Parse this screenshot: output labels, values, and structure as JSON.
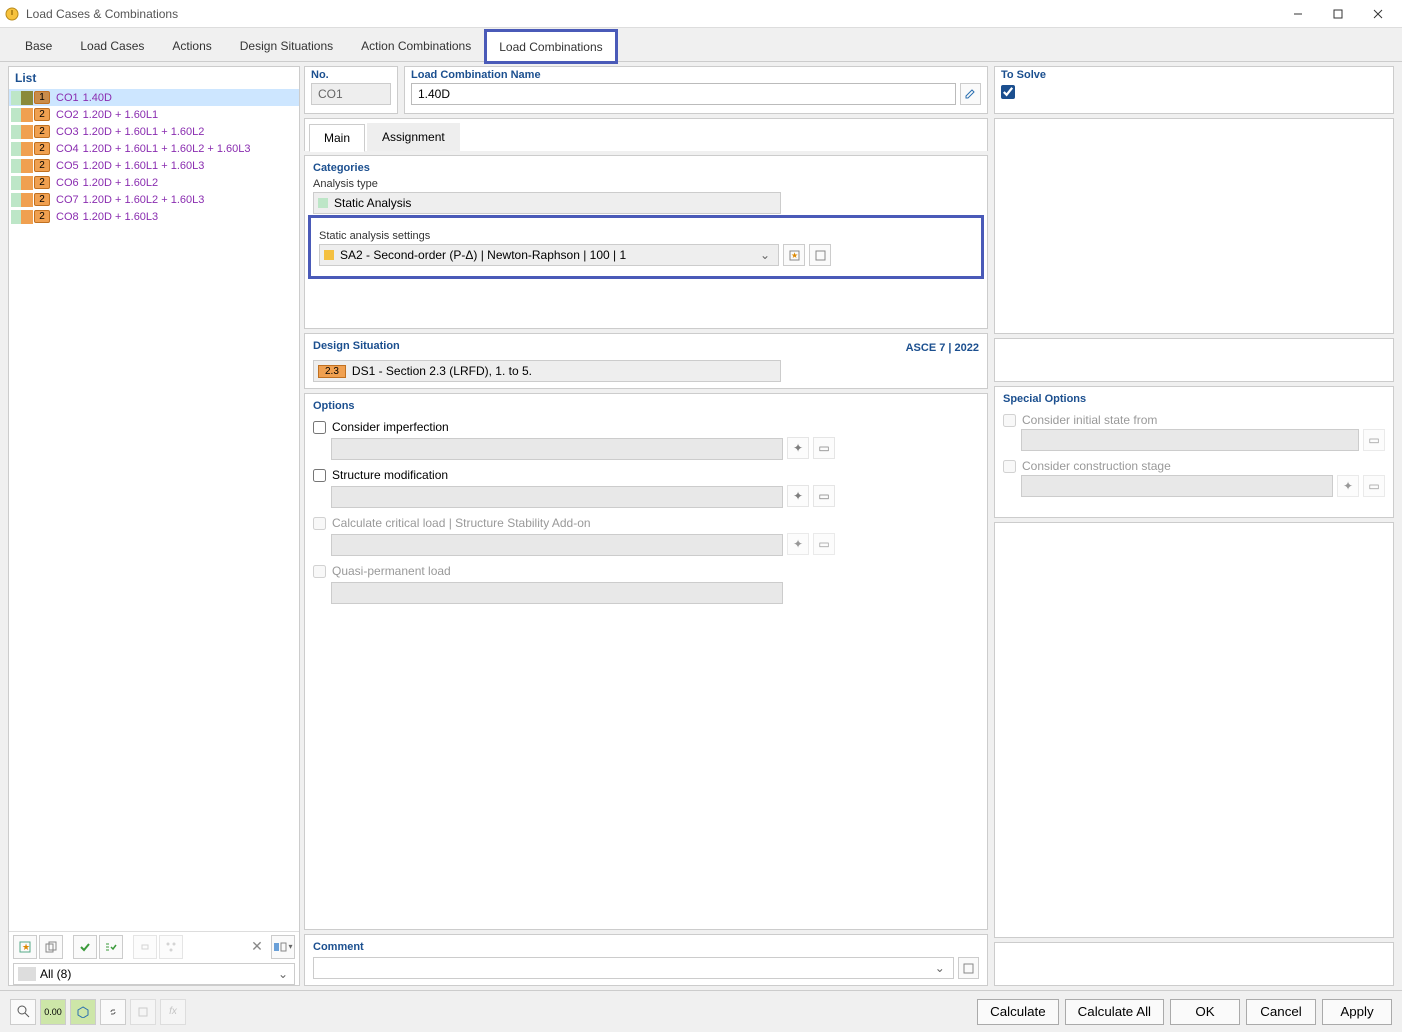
{
  "window": {
    "title": "Load Cases & Combinations"
  },
  "tabs": {
    "items": [
      "Base",
      "Load Cases",
      "Actions",
      "Design Situations",
      "Action Combinations",
      "Load Combinations"
    ],
    "active": 5
  },
  "list": {
    "header": "List",
    "rows": [
      {
        "idx": "1",
        "co": "CO1",
        "name": "1.40D",
        "sw1": "#bde6c7",
        "sw2": "#8a8a3a",
        "sel": true
      },
      {
        "idx": "2",
        "co": "CO2",
        "name": "1.20D + 1.60L1",
        "sw1": "#bde6c7",
        "sw2": "#f0a050",
        "sel": false
      },
      {
        "idx": "2",
        "co": "CO3",
        "name": "1.20D + 1.60L1 + 1.60L2",
        "sw1": "#bde6c7",
        "sw2": "#f0a050",
        "sel": false
      },
      {
        "idx": "2",
        "co": "CO4",
        "name": "1.20D + 1.60L1 + 1.60L2 + 1.60L3",
        "sw1": "#bde6c7",
        "sw2": "#f0a050",
        "sel": false
      },
      {
        "idx": "2",
        "co": "CO5",
        "name": "1.20D + 1.60L1 + 1.60L3",
        "sw1": "#bde6c7",
        "sw2": "#f0a050",
        "sel": false
      },
      {
        "idx": "2",
        "co": "CO6",
        "name": "1.20D + 1.60L2",
        "sw1": "#bde6c7",
        "sw2": "#f0a050",
        "sel": false
      },
      {
        "idx": "2",
        "co": "CO7",
        "name": "1.20D + 1.60L2 + 1.60L3",
        "sw1": "#bde6c7",
        "sw2": "#f0a050",
        "sel": false
      },
      {
        "idx": "2",
        "co": "CO8",
        "name": "1.20D + 1.60L3",
        "sw1": "#bde6c7",
        "sw2": "#f0a050",
        "sel": false
      }
    ],
    "filter": "All (8)"
  },
  "detail": {
    "no_label": "No.",
    "no_value": "CO1",
    "name_label": "Load Combination Name",
    "name_value": "1.40D",
    "solve_label": "To Solve",
    "subtabs": [
      "Main",
      "Assignment"
    ],
    "categories": {
      "title": "Categories",
      "analysis_type_label": "Analysis type",
      "analysis_type_value": "Static Analysis",
      "sas_label": "Static analysis settings",
      "sas_value": "SA2 - Second-order (P-Δ) | Newton-Raphson | 100 | 1"
    },
    "design_situation": {
      "title": "Design Situation",
      "right": "ASCE 7 | 2022",
      "badge": "2.3",
      "value": "DS1 - Section 2.3 (LRFD), 1. to 5."
    },
    "options": {
      "title": "Options",
      "imperf": "Consider imperfection",
      "struct_mod": "Structure modification",
      "crit_load": "Calculate critical load | Structure Stability Add-on",
      "quasi": "Quasi-permanent load"
    },
    "special": {
      "title": "Special Options",
      "init_state": "Consider initial state from",
      "constr_stage": "Consider construction stage"
    },
    "comment": {
      "title": "Comment"
    }
  },
  "buttons": {
    "calculate": "Calculate",
    "calculate_all": "Calculate All",
    "ok": "OK",
    "cancel": "Cancel",
    "apply": "Apply"
  }
}
